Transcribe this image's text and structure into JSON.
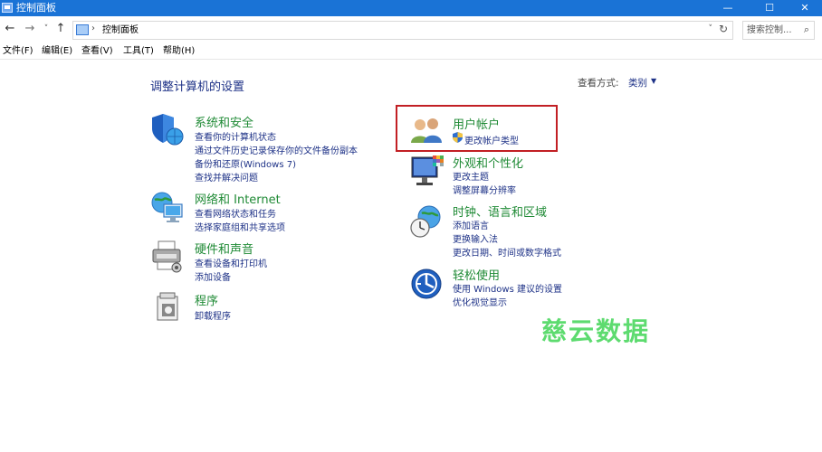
{
  "window": {
    "title": "控制面板",
    "minimize_label": "—",
    "maximize_label": "☐",
    "close_label": "✕"
  },
  "nav": {
    "back": "←",
    "forward": "→",
    "dropdown": "˅",
    "up": "↑",
    "address_separator": "›",
    "address_path": "控制面板",
    "address_dropdown": "˅",
    "refresh": "↻",
    "search_placeholder": "搜索控制...",
    "search_icon": "⌕"
  },
  "menu": [
    {
      "label": "文件(F)"
    },
    {
      "label": "编辑(E)"
    },
    {
      "label": "查看(V)"
    },
    {
      "label": "工具(T)"
    },
    {
      "label": "帮助(H)"
    }
  ],
  "main": {
    "heading": "调整计算机的设置",
    "view_by_label": "查看方式:",
    "view_by_value": "类别",
    "view_by_caret": "▼"
  },
  "categories": {
    "system": {
      "title": "系统和安全",
      "links": [
        "查看你的计算机状态",
        "通过文件历史记录保存你的文件备份副本",
        "备份和还原(Windows 7)",
        "查找并解决问题"
      ]
    },
    "network": {
      "title": "网络和 Internet",
      "links": [
        "查看网络状态和任务",
        "选择家庭组和共享选项"
      ]
    },
    "hardware": {
      "title": "硬件和声音",
      "links": [
        "查看设备和打印机",
        "添加设备"
      ]
    },
    "programs": {
      "title": "程序",
      "links": [
        "卸载程序"
      ]
    },
    "accounts": {
      "title": "用户帐户",
      "links": [
        "更改帐户类型"
      ]
    },
    "appearance": {
      "title": "外观和个性化",
      "links": [
        "更改主题",
        "调整屏幕分辨率"
      ]
    },
    "clock": {
      "title": "时钟、语言和区域",
      "links": [
        "添加语言",
        "更换输入法",
        "更改日期、时间或数字格式"
      ]
    },
    "ease": {
      "title": "轻松使用",
      "links": [
        "使用 Windows 建议的设置",
        "优化视觉显示"
      ]
    }
  },
  "watermark": "慈云数据",
  "colors": {
    "titlebar": "#1a73d6",
    "category_title": "#1f8a35",
    "link": "#1e3287",
    "highlight": "#c21f24",
    "watermark": "#5ddb6f"
  }
}
